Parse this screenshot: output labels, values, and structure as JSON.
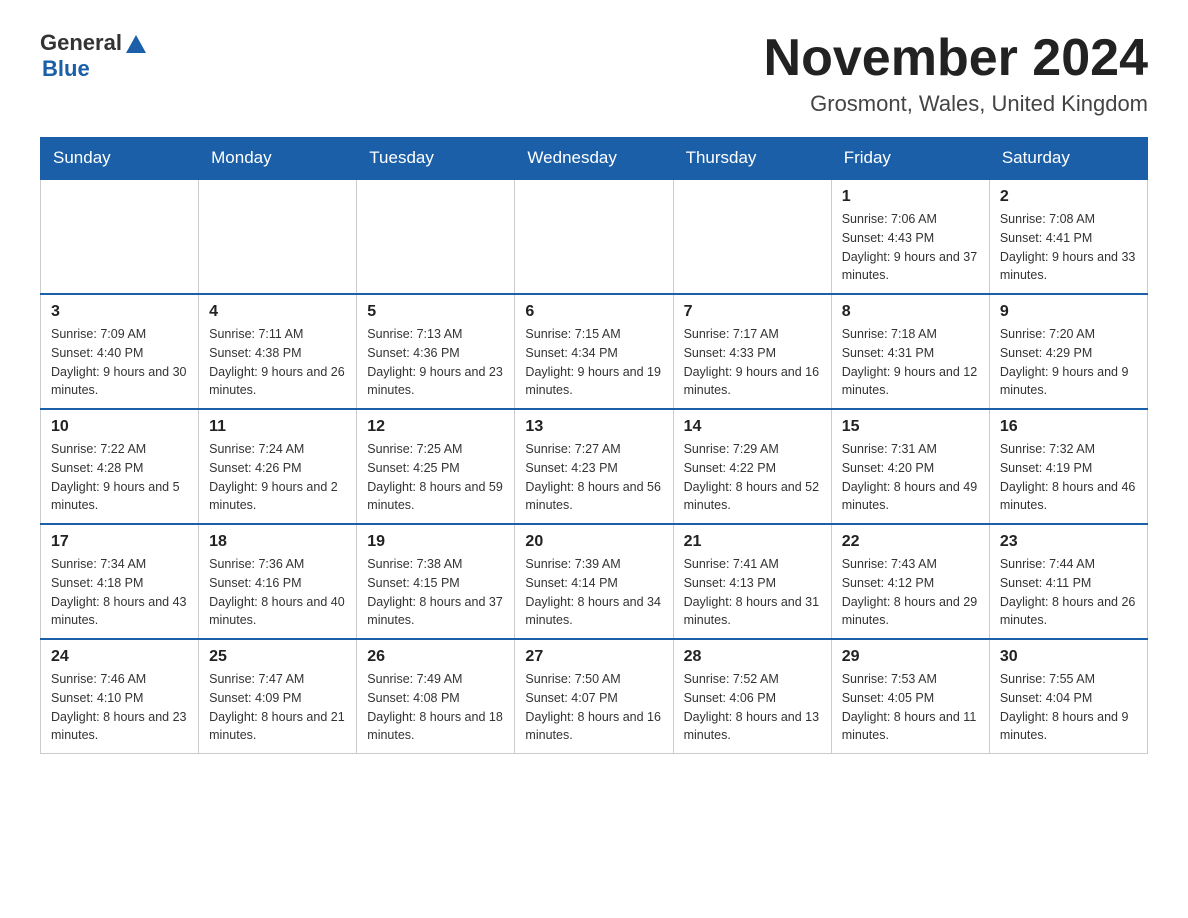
{
  "header": {
    "logo": {
      "general": "General",
      "blue": "Blue"
    },
    "title": "November 2024",
    "location": "Grosmont, Wales, United Kingdom"
  },
  "calendar": {
    "days_of_week": [
      "Sunday",
      "Monday",
      "Tuesday",
      "Wednesday",
      "Thursday",
      "Friday",
      "Saturday"
    ],
    "weeks": [
      [
        {
          "day": "",
          "info": ""
        },
        {
          "day": "",
          "info": ""
        },
        {
          "day": "",
          "info": ""
        },
        {
          "day": "",
          "info": ""
        },
        {
          "day": "",
          "info": ""
        },
        {
          "day": "1",
          "info": "Sunrise: 7:06 AM\nSunset: 4:43 PM\nDaylight: 9 hours and 37 minutes."
        },
        {
          "day": "2",
          "info": "Sunrise: 7:08 AM\nSunset: 4:41 PM\nDaylight: 9 hours and 33 minutes."
        }
      ],
      [
        {
          "day": "3",
          "info": "Sunrise: 7:09 AM\nSunset: 4:40 PM\nDaylight: 9 hours and 30 minutes."
        },
        {
          "day": "4",
          "info": "Sunrise: 7:11 AM\nSunset: 4:38 PM\nDaylight: 9 hours and 26 minutes."
        },
        {
          "day": "5",
          "info": "Sunrise: 7:13 AM\nSunset: 4:36 PM\nDaylight: 9 hours and 23 minutes."
        },
        {
          "day": "6",
          "info": "Sunrise: 7:15 AM\nSunset: 4:34 PM\nDaylight: 9 hours and 19 minutes."
        },
        {
          "day": "7",
          "info": "Sunrise: 7:17 AM\nSunset: 4:33 PM\nDaylight: 9 hours and 16 minutes."
        },
        {
          "day": "8",
          "info": "Sunrise: 7:18 AM\nSunset: 4:31 PM\nDaylight: 9 hours and 12 minutes."
        },
        {
          "day": "9",
          "info": "Sunrise: 7:20 AM\nSunset: 4:29 PM\nDaylight: 9 hours and 9 minutes."
        }
      ],
      [
        {
          "day": "10",
          "info": "Sunrise: 7:22 AM\nSunset: 4:28 PM\nDaylight: 9 hours and 5 minutes."
        },
        {
          "day": "11",
          "info": "Sunrise: 7:24 AM\nSunset: 4:26 PM\nDaylight: 9 hours and 2 minutes."
        },
        {
          "day": "12",
          "info": "Sunrise: 7:25 AM\nSunset: 4:25 PM\nDaylight: 8 hours and 59 minutes."
        },
        {
          "day": "13",
          "info": "Sunrise: 7:27 AM\nSunset: 4:23 PM\nDaylight: 8 hours and 56 minutes."
        },
        {
          "day": "14",
          "info": "Sunrise: 7:29 AM\nSunset: 4:22 PM\nDaylight: 8 hours and 52 minutes."
        },
        {
          "day": "15",
          "info": "Sunrise: 7:31 AM\nSunset: 4:20 PM\nDaylight: 8 hours and 49 minutes."
        },
        {
          "day": "16",
          "info": "Sunrise: 7:32 AM\nSunset: 4:19 PM\nDaylight: 8 hours and 46 minutes."
        }
      ],
      [
        {
          "day": "17",
          "info": "Sunrise: 7:34 AM\nSunset: 4:18 PM\nDaylight: 8 hours and 43 minutes."
        },
        {
          "day": "18",
          "info": "Sunrise: 7:36 AM\nSunset: 4:16 PM\nDaylight: 8 hours and 40 minutes."
        },
        {
          "day": "19",
          "info": "Sunrise: 7:38 AM\nSunset: 4:15 PM\nDaylight: 8 hours and 37 minutes."
        },
        {
          "day": "20",
          "info": "Sunrise: 7:39 AM\nSunset: 4:14 PM\nDaylight: 8 hours and 34 minutes."
        },
        {
          "day": "21",
          "info": "Sunrise: 7:41 AM\nSunset: 4:13 PM\nDaylight: 8 hours and 31 minutes."
        },
        {
          "day": "22",
          "info": "Sunrise: 7:43 AM\nSunset: 4:12 PM\nDaylight: 8 hours and 29 minutes."
        },
        {
          "day": "23",
          "info": "Sunrise: 7:44 AM\nSunset: 4:11 PM\nDaylight: 8 hours and 26 minutes."
        }
      ],
      [
        {
          "day": "24",
          "info": "Sunrise: 7:46 AM\nSunset: 4:10 PM\nDaylight: 8 hours and 23 minutes."
        },
        {
          "day": "25",
          "info": "Sunrise: 7:47 AM\nSunset: 4:09 PM\nDaylight: 8 hours and 21 minutes."
        },
        {
          "day": "26",
          "info": "Sunrise: 7:49 AM\nSunset: 4:08 PM\nDaylight: 8 hours and 18 minutes."
        },
        {
          "day": "27",
          "info": "Sunrise: 7:50 AM\nSunset: 4:07 PM\nDaylight: 8 hours and 16 minutes."
        },
        {
          "day": "28",
          "info": "Sunrise: 7:52 AM\nSunset: 4:06 PM\nDaylight: 8 hours and 13 minutes."
        },
        {
          "day": "29",
          "info": "Sunrise: 7:53 AM\nSunset: 4:05 PM\nDaylight: 8 hours and 11 minutes."
        },
        {
          "day": "30",
          "info": "Sunrise: 7:55 AM\nSunset: 4:04 PM\nDaylight: 8 hours and 9 minutes."
        }
      ]
    ]
  }
}
